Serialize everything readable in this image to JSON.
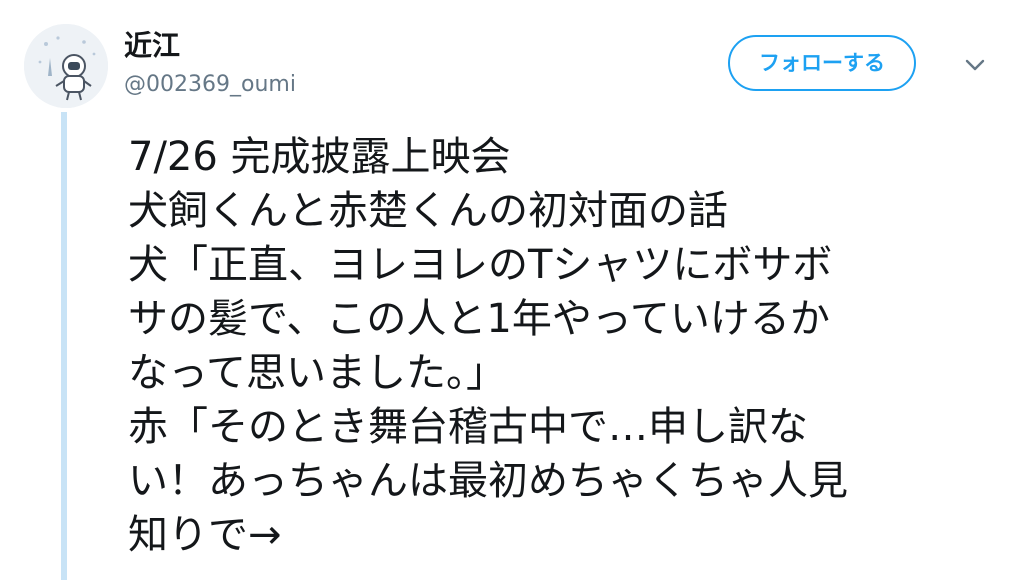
{
  "tweet": {
    "author": {
      "display_name": "近江",
      "handle": "@002369_oumi",
      "avatar_icon": "astronaut-avatar-icon"
    },
    "follow_label": "フォローする",
    "menu_icon": "chevron-down-icon",
    "accent_color": "#1da1f2",
    "thread_line_color": "#c8e3f6",
    "lines": [
      "7/26 完成披露上映会",
      "犬飼くんと赤楚くんの初対面の話",
      "犬「正直、ヨレヨレのTシャツにボサボ",
      "サの髪で、この人と1年やっていけるか",
      "なって思いました。」",
      "赤「そのとき舞台稽古中で…申し訳な",
      "い！あっちゃんは最初めちゃくちゃ人見",
      "知りで→"
    ]
  }
}
